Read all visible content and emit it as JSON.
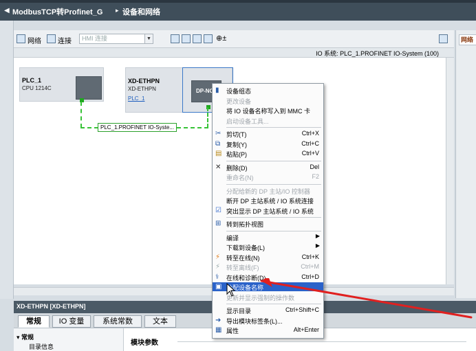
{
  "breadcrumb": [
    "ModbusTCP转Profinet_G",
    "设备和网络"
  ],
  "toolbar": {
    "network_label": "网络",
    "connect_label": "连接",
    "hmi_connection": "HMI 连接"
  },
  "io_system_label": "IO 系统: PLC_1.PROFINET IO-System (100)",
  "devices": {
    "plc": {
      "name": "PLC_1",
      "type": "CPU 1214C"
    },
    "xd": {
      "name": "XD-ETHPN",
      "type": "XD-ETHPN",
      "controller_link": "PLC_1",
      "module_label": "DP-NO"
    }
  },
  "bus_label": "PLC_1.PROFINET IO-Syste...",
  "right_panel_tab": "网络",
  "context_menu": [
    {
      "label": "设备组态",
      "shortcut": "",
      "disabled": false,
      "icon": "device-config-icon"
    },
    {
      "label": "更改设备",
      "shortcut": "",
      "disabled": true,
      "icon": ""
    },
    {
      "label": "将 IO 设备名称写入到 MMC 卡",
      "shortcut": "",
      "disabled": false,
      "icon": ""
    },
    {
      "label": "启动设备工具...",
      "shortcut": "",
      "disabled": true,
      "icon": ""
    },
    {
      "label": "剪切(T)",
      "shortcut": "Ctrl+X",
      "disabled": false,
      "icon": "cut-icon"
    },
    {
      "label": "复制(Y)",
      "shortcut": "Ctrl+C",
      "disabled": false,
      "icon": "copy-icon"
    },
    {
      "label": "粘贴(P)",
      "shortcut": "Ctrl+V",
      "disabled": false,
      "icon": "paste-icon"
    },
    {
      "label": "删除(D)",
      "shortcut": "Del",
      "disabled": false,
      "icon": "delete-icon"
    },
    {
      "label": "重命名(N)",
      "shortcut": "F2",
      "disabled": true,
      "icon": ""
    },
    {
      "label": "分配给新的 DP 主站/IO 控制器",
      "shortcut": "",
      "disabled": true,
      "icon": ""
    },
    {
      "label": "断开 DP 主站系统 / IO 系统连接",
      "shortcut": "",
      "disabled": false,
      "icon": ""
    },
    {
      "label": "突出显示 DP 主站系统 / IO 系统",
      "shortcut": "",
      "disabled": false,
      "icon": "checkbox-icon"
    },
    {
      "label": "转到拓扑视图",
      "shortcut": "",
      "disabled": false,
      "icon": "topology-icon"
    },
    {
      "label": "编译",
      "shortcut": "",
      "disabled": false,
      "icon": "",
      "submenu": true
    },
    {
      "label": "下载到设备(L)",
      "shortcut": "",
      "disabled": false,
      "icon": "",
      "submenu": true
    },
    {
      "label": "转至在线(N)",
      "shortcut": "Ctrl+K",
      "disabled": false,
      "icon": "go-online-icon"
    },
    {
      "label": "转至离线(F)",
      "shortcut": "Ctrl+M",
      "disabled": true,
      "icon": "go-offline-icon"
    },
    {
      "label": "在线和诊断(D)",
      "shortcut": "Ctrl+D",
      "disabled": false,
      "icon": "diagnostics-icon"
    },
    {
      "label": "分配设备名称",
      "shortcut": "",
      "disabled": false,
      "icon": "assign-name-icon",
      "highlighted": true
    },
    {
      "label": "更新并显示强制的操作数",
      "shortcut": "",
      "disabled": true,
      "icon": ""
    },
    {
      "label": "显示目录",
      "shortcut": "Ctrl+Shift+C",
      "disabled": false,
      "icon": ""
    },
    {
      "label": "导出模块标签条(L)...",
      "shortcut": "",
      "disabled": false,
      "icon": "export-icon"
    },
    {
      "label": "属性",
      "shortcut": "Alt+Enter",
      "disabled": false,
      "icon": "properties-icon"
    }
  ],
  "properties": {
    "header": "XD-ETHPN [XD-ETHPN]",
    "tabs": [
      "常规",
      "IO 变量",
      "系统常数",
      "文本"
    ],
    "tree_general": "▾ 常规",
    "tree_catalog": "目录信息",
    "section_title": "模块参数"
  },
  "colors": {
    "accent_highlight": "#2a62c9",
    "bus_green": "#35c235",
    "title_bar": "#3f4e5a",
    "arrow_red": "#e0201f"
  }
}
